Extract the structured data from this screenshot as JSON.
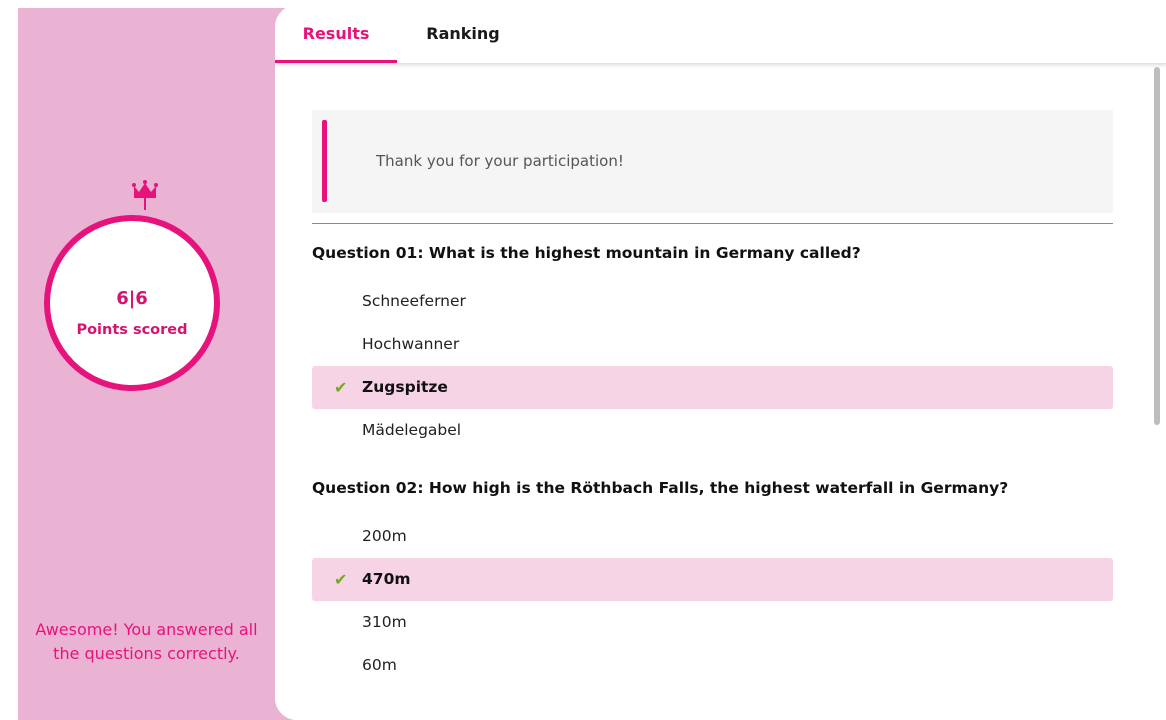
{
  "sidebar": {
    "score": "6|6",
    "score_label": "Points scored",
    "message": "Awesome! You answered all the questions correctly.",
    "crown_icon": "crown-icon"
  },
  "tabs": [
    {
      "label": "Results",
      "active": true
    },
    {
      "label": "Ranking",
      "active": false
    }
  ],
  "notice": {
    "text": "Thank you for your participation!"
  },
  "questions": [
    {
      "label": "Question 01:  What is the highest mountain in Germany called?",
      "answers": [
        {
          "text": "Schneeferner",
          "correct": false
        },
        {
          "text": "Hochwanner",
          "correct": false
        },
        {
          "text": "Zugspitze",
          "correct": true
        },
        {
          "text": "Mädelegabel",
          "correct": false
        }
      ]
    },
    {
      "label": "Question 02:  How high is the Röthbach Falls, the highest waterfall in Germany?",
      "answers": [
        {
          "text": "200m",
          "correct": false
        },
        {
          "text": "470m",
          "correct": true
        },
        {
          "text": "310m",
          "correct": false
        },
        {
          "text": "60m",
          "correct": false
        }
      ]
    }
  ],
  "colors": {
    "accent": "#e6137c",
    "sidebar_bg": "#ebb3d3",
    "correct_bg": "#f7d3e6",
    "check": "#74a71e"
  }
}
